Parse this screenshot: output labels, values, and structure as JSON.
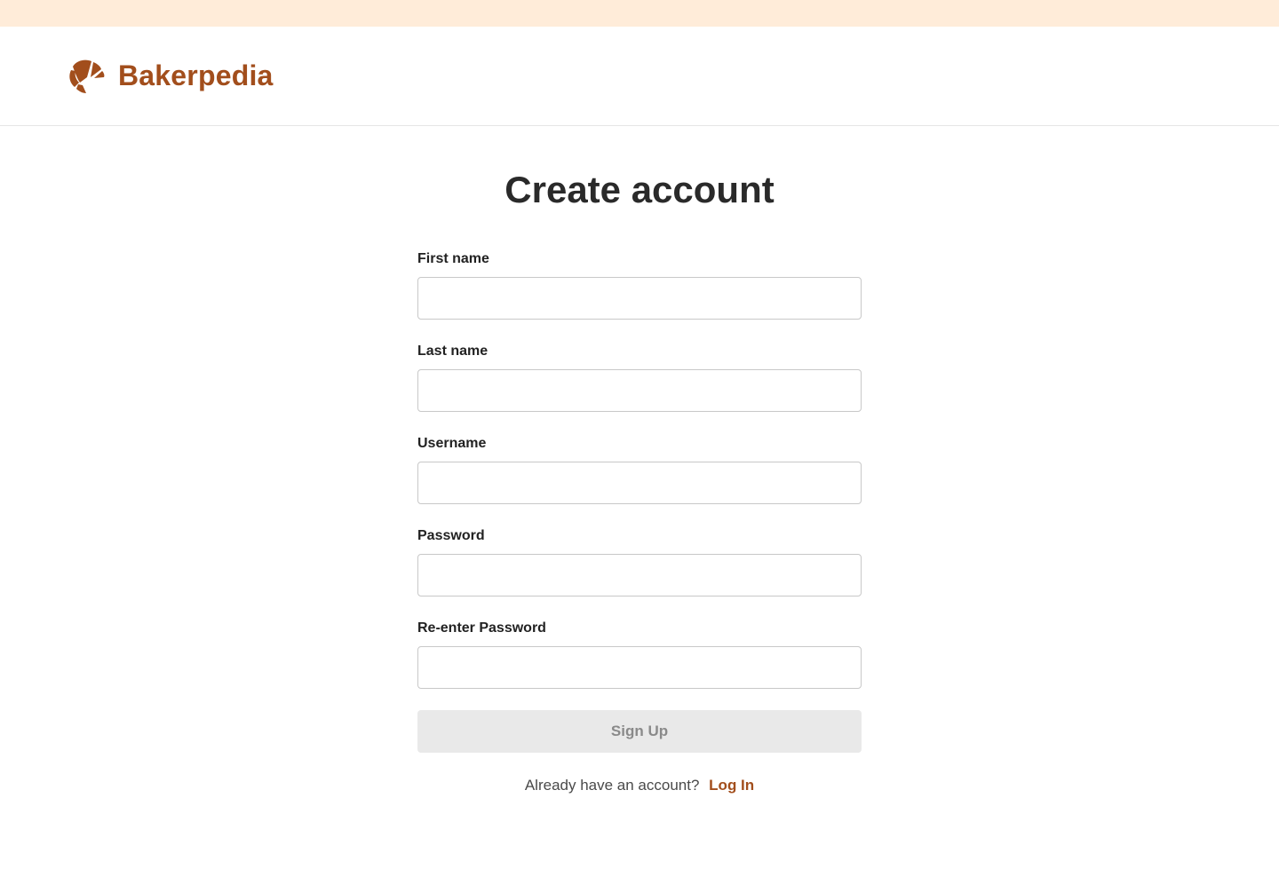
{
  "brand": {
    "name": "Bakerpedia",
    "icon": "croissant-icon",
    "color": "#a24e1c"
  },
  "colors": {
    "top_strip": "#ffecd9",
    "accent": "#a24e1c",
    "button_disabled_bg": "#e9e9e9",
    "button_disabled_text": "#8a8a8a"
  },
  "page": {
    "title": "Create account"
  },
  "form": {
    "fields": [
      {
        "label": "First name",
        "value": "",
        "placeholder": ""
      },
      {
        "label": "Last name",
        "value": "",
        "placeholder": ""
      },
      {
        "label": "Username",
        "value": "",
        "placeholder": ""
      },
      {
        "label": "Password",
        "value": "",
        "placeholder": ""
      },
      {
        "label": "Re-enter Password",
        "value": "",
        "placeholder": ""
      }
    ],
    "submit_label": "Sign Up",
    "submit_state": "disabled"
  },
  "footer": {
    "prompt": "Already have an account?",
    "login_label": "Log In"
  }
}
